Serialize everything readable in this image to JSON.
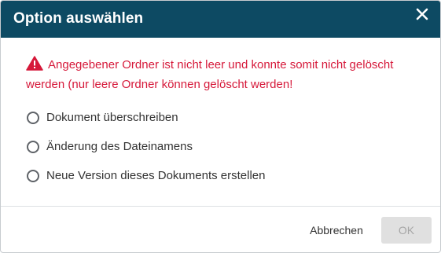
{
  "dialog": {
    "title": "Option auswählen",
    "close_icon": "close-icon",
    "header_color": "#0d4a63"
  },
  "warning": {
    "icon": "warning-triangle-icon",
    "color": "#d6193a",
    "text": "Angegebener Ordner ist nicht leer und konnte somit nicht gelöscht werden (nur leere Ordner können gelöscht werden!"
  },
  "options": [
    {
      "label": "Dokument überschreiben",
      "selected": false
    },
    {
      "label": "Änderung des Dateinamens",
      "selected": false
    },
    {
      "label": "Neue Version dieses Dokuments erstellen",
      "selected": false
    }
  ],
  "footer": {
    "cancel_label": "Abbrechen",
    "ok_label": "OK",
    "ok_disabled": true
  }
}
